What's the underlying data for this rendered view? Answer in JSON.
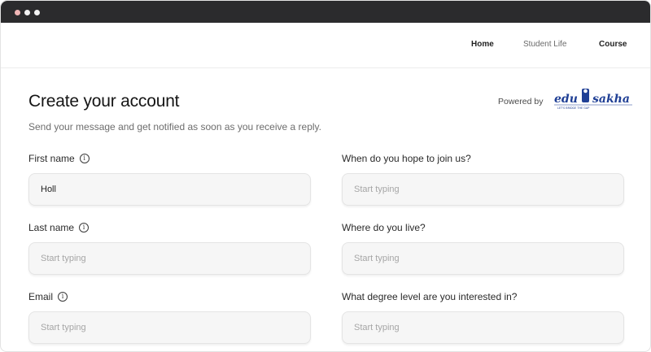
{
  "window": {
    "controls": [
      "close",
      "minimize",
      "maximize"
    ]
  },
  "nav": {
    "items": [
      {
        "label": "Home"
      },
      {
        "label": "Student Life"
      },
      {
        "label": "Course"
      }
    ]
  },
  "header": {
    "title": "Create your account",
    "subtitle": "Send your message and get notified as soon as you receive a reply.",
    "powered_by": "Powered by",
    "logo_text": "edu sakha",
    "logo_tagline": "LET'S BRIDGE THE GAP",
    "logo_color": "#1f3f95"
  },
  "form": {
    "first_name": {
      "label": "First name",
      "value": "Holl",
      "placeholder": "Start typing",
      "info_icon": "info-icon"
    },
    "last_name": {
      "label": "Last name",
      "value": "",
      "placeholder": "Start typing",
      "info_icon": "info-icon"
    },
    "email": {
      "label": "Email",
      "value": "",
      "placeholder": "Start typing",
      "info_icon": "info-icon"
    },
    "join_when": {
      "label": "When do you hope to join us?",
      "value": "",
      "placeholder": "Start typing"
    },
    "location": {
      "label": "Where do you live?",
      "value": "",
      "placeholder": "Start typing"
    },
    "degree_level": {
      "label": "What degree level are you interested in?",
      "value": "",
      "placeholder": "Start typing"
    }
  }
}
